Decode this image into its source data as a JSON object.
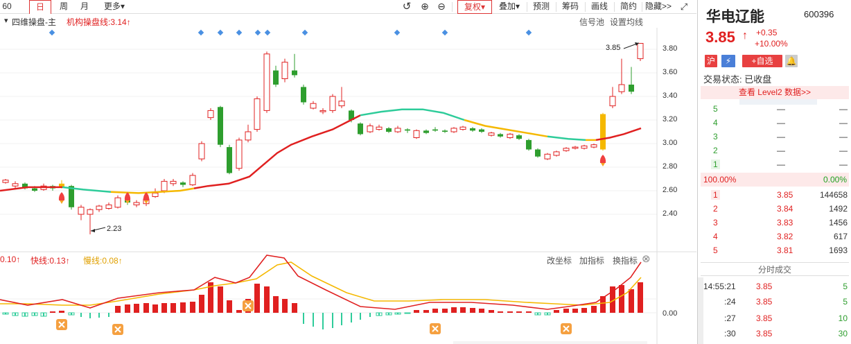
{
  "toolbar": {
    "items": [
      "60",
      "日",
      "周",
      "月",
      "更多▾"
    ],
    "right_items": [
      "复权▾",
      "叠加▾",
      "预测",
      "筹码",
      "画线",
      "简约",
      "隐藏>>"
    ]
  },
  "main_chart": {
    "indicator_name": "四维操盘-主",
    "indicator_value": "机构操盘线:3.14↑",
    "signal_pool": "信号池",
    "ma_settings": "设置均线",
    "y_ticks": [
      "3.80",
      "3.60",
      "3.40",
      "3.20",
      "3.00",
      "2.80",
      "2.60",
      "2.40"
    ],
    "high_marker": "3.85",
    "low_marker": "2.23"
  },
  "sub_chart": {
    "prefix": "0.10↑",
    "fast_line": "快线:0.13↑",
    "slow_line": "慢线:0.08↑",
    "buttons": [
      "改坐标",
      "加指标",
      "换指标"
    ],
    "y_tick": "0.00",
    "close_icon": "⊗"
  },
  "colors": {
    "up": "#e02020",
    "down": "#2e9e2e",
    "slow": "#f5b800",
    "ma_teal": "#2ecc9a"
  },
  "right_panel": {
    "name": "华电辽能",
    "code": "600396",
    "price": "3.85",
    "arrow": "↑",
    "change": "+0.35",
    "change_pct": "+10.00%",
    "badge_market": "沪",
    "badge_add": "+自选",
    "status": "交易状态: 已收盘",
    "level2": "查看 Level2 数据>>",
    "sell_levels": [
      {
        "level": "5",
        "price": "—",
        "vol": "—"
      },
      {
        "level": "4",
        "price": "—",
        "vol": "—"
      },
      {
        "level": "3",
        "price": "—",
        "vol": "—"
      },
      {
        "level": "2",
        "price": "—",
        "vol": "—"
      },
      {
        "level": "1",
        "price": "—",
        "vol": "—"
      }
    ],
    "buy_pct": "100.00%",
    "sell_pct": "0.00%",
    "buy_levels": [
      {
        "level": "1",
        "price": "3.85",
        "vol": "144658"
      },
      {
        "level": "2",
        "price": "3.84",
        "vol": "1492"
      },
      {
        "level": "3",
        "price": "3.83",
        "vol": "1456"
      },
      {
        "level": "4",
        "price": "3.82",
        "vol": "617"
      },
      {
        "level": "5",
        "price": "3.81",
        "vol": "1693"
      }
    ],
    "trades_title": "分时成交",
    "trades": [
      {
        "time": "14:55:21",
        "price": "3.85",
        "vol": "5"
      },
      {
        "time": ":24",
        "price": "3.85",
        "vol": "5"
      },
      {
        "time": ":27",
        "price": "3.85",
        "vol": "10"
      },
      {
        "time": ":30",
        "price": "3.85",
        "vol": "30"
      }
    ]
  }
}
